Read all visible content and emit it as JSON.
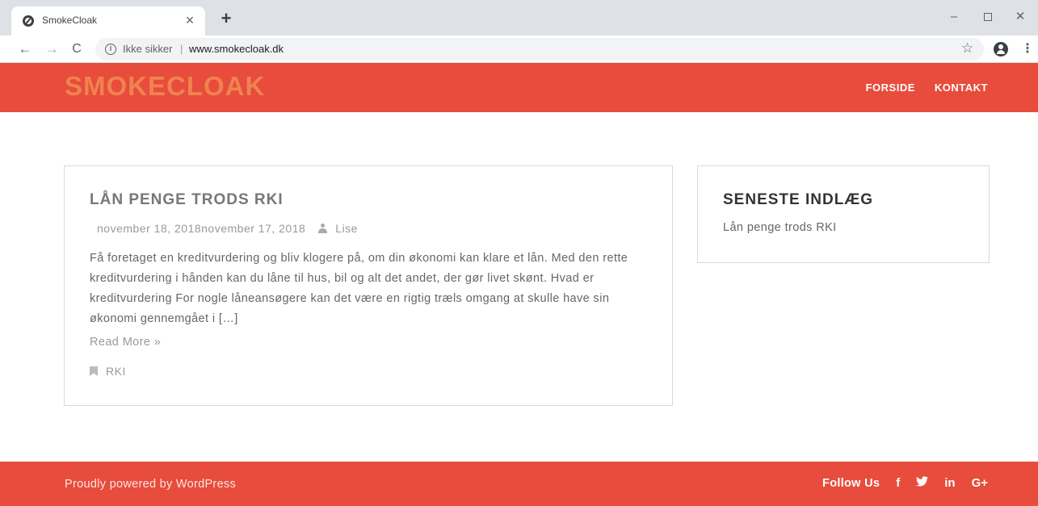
{
  "browser": {
    "tab_title": "SmokeCloak",
    "tab_close": "×",
    "new_tab": "+",
    "security_label": "Ikke sikker",
    "separator": "|",
    "url": "www.smokecloak.dk",
    "icons": {
      "back": "←",
      "forward": "→",
      "reload": "C",
      "star": "☆",
      "menu": "⋮",
      "minimize": "–",
      "close": "✕",
      "info": "i"
    }
  },
  "header": {
    "logo": "SMOKECLOAK",
    "nav": [
      {
        "label": "FORSIDE"
      },
      {
        "label": "KONTAKT"
      }
    ],
    "colors": {
      "background": "#e74c3c",
      "logo": "#f0824f"
    }
  },
  "post": {
    "title": "LÅN PENGE TRODS RKI",
    "dates": "november 18, 2018november 17, 2018",
    "author": "Lise",
    "excerpt": "Få foretaget en kreditvurdering og bliv klogere på, om din økonomi kan klare et lån. Med den rette kreditvurdering i hånden kan du låne til hus, bil og alt det andet, der gør livet skønt. Hvad er kreditvurdering For nogle låneansøgere kan det være en rigtig træls omgang at skulle have sin økonomi gennemgået i […]",
    "read_more": "Read More »",
    "category": "RKI"
  },
  "sidebar": {
    "widget_title": "SENESTE INDLÆG",
    "recent_posts": [
      {
        "label": "Lån penge trods RKI"
      }
    ]
  },
  "footer": {
    "credit": "Proudly powered by WordPress",
    "follow_label": "Follow Us",
    "social": [
      {
        "name": "facebook",
        "label": "f"
      },
      {
        "name": "twitter",
        "label": "🐦"
      },
      {
        "name": "linkedin",
        "label": "in"
      },
      {
        "name": "google-plus",
        "label": "G+"
      }
    ]
  }
}
